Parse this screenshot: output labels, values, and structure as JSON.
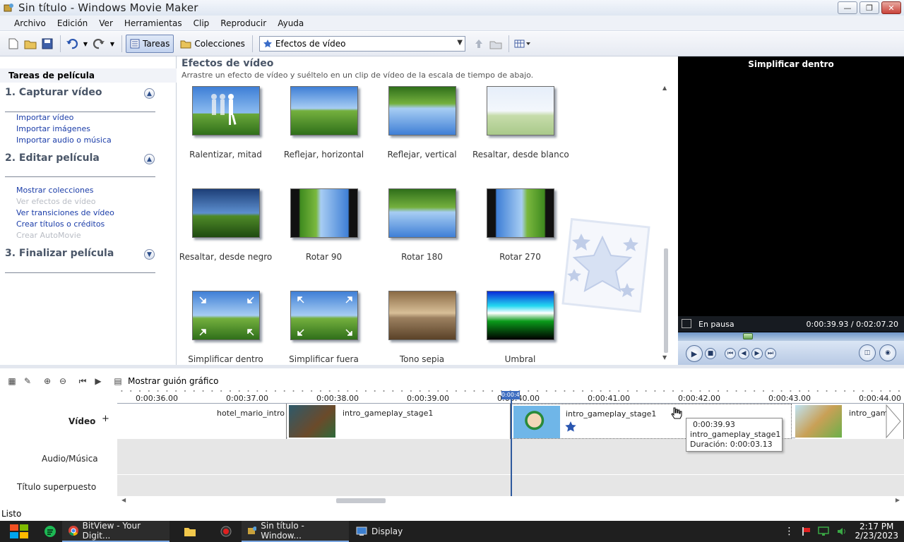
{
  "window": {
    "title": "Sin título - Windows Movie Maker",
    "minimize": "—",
    "maximize": "❐",
    "close": "✕"
  },
  "menu": [
    "Archivo",
    "Edición",
    "Ver",
    "Herramientas",
    "Clip",
    "Reproducir",
    "Ayuda"
  ],
  "toolbar": {
    "tasks_label": "Tareas",
    "collections_label": "Colecciones",
    "combo_value": "Efectos de vídeo"
  },
  "taskpane": {
    "header": "Tareas de película",
    "sections": [
      {
        "title": "1. Capturar vídeo",
        "links": [
          "Importar vídeo",
          "Importar imágenes",
          "Importar audio o música"
        ]
      },
      {
        "title": "2. Editar película",
        "links": [
          "Mostrar colecciones",
          "Ver efectos de vídeo",
          "Ver transiciones de vídeo",
          "Crear títulos o créditos",
          "Crear AutoMovie"
        ]
      },
      {
        "title": "3. Finalizar película",
        "links": []
      }
    ]
  },
  "effects": {
    "title": "Efectos de vídeo",
    "subtitle": "Arrastre un efecto de vídeo y suéltelo en un clip de vídeo de la escala de tiempo de abajo.",
    "items": [
      "Ralentizar, mitad",
      "Reflejar, horizontal",
      "Reflejar, vertical",
      "Resaltar, desde blanco",
      "Resaltar, desde negro",
      "Rotar 90",
      "Rotar 180",
      "Rotar 270",
      "Simplificar dentro",
      "Simplificar fuera",
      "Tono sepia",
      "Umbral"
    ]
  },
  "monitor": {
    "title": "Simplificar dentro",
    "status": "En pausa",
    "time": "0:00:39.93 / 0:02:07.20",
    "seek_fraction": 0.31
  },
  "timeline": {
    "toggle_label": "Mostrar guión gráfico",
    "ticks": [
      "0:00:36.00",
      "0:00:37.00",
      "0:00:38.00",
      "0:00:39.00",
      "0:00:40.00",
      "0:00:41.00",
      "0:00:42.00",
      "0:00:43.00",
      "0:00:44.00"
    ],
    "playhead_label": "0:00:40.00",
    "tracks": {
      "video": "Vídeo",
      "video_expand": "+",
      "audio": "Audio/Música",
      "title": "Título superpuesto"
    },
    "clips": [
      {
        "name": "hotel_mario_intro"
      },
      {
        "name": "intro_gameplay_stage1"
      },
      {
        "name": "intro_gameplay_stage1"
      },
      {
        "name": "intro_game"
      }
    ],
    "tooltip": {
      "time": "0:00:39.93",
      "name": "intro_gameplay_stage1",
      "duration_label": "Duración:",
      "duration_value": "0:00:03.13"
    }
  },
  "statusbar": {
    "text": "Listo"
  },
  "taskbar": {
    "items": [
      "BitView - Your Digit...",
      "Sin título - Window...",
      "Display"
    ],
    "time": "2:17 PM",
    "date": "2/23/2023"
  }
}
